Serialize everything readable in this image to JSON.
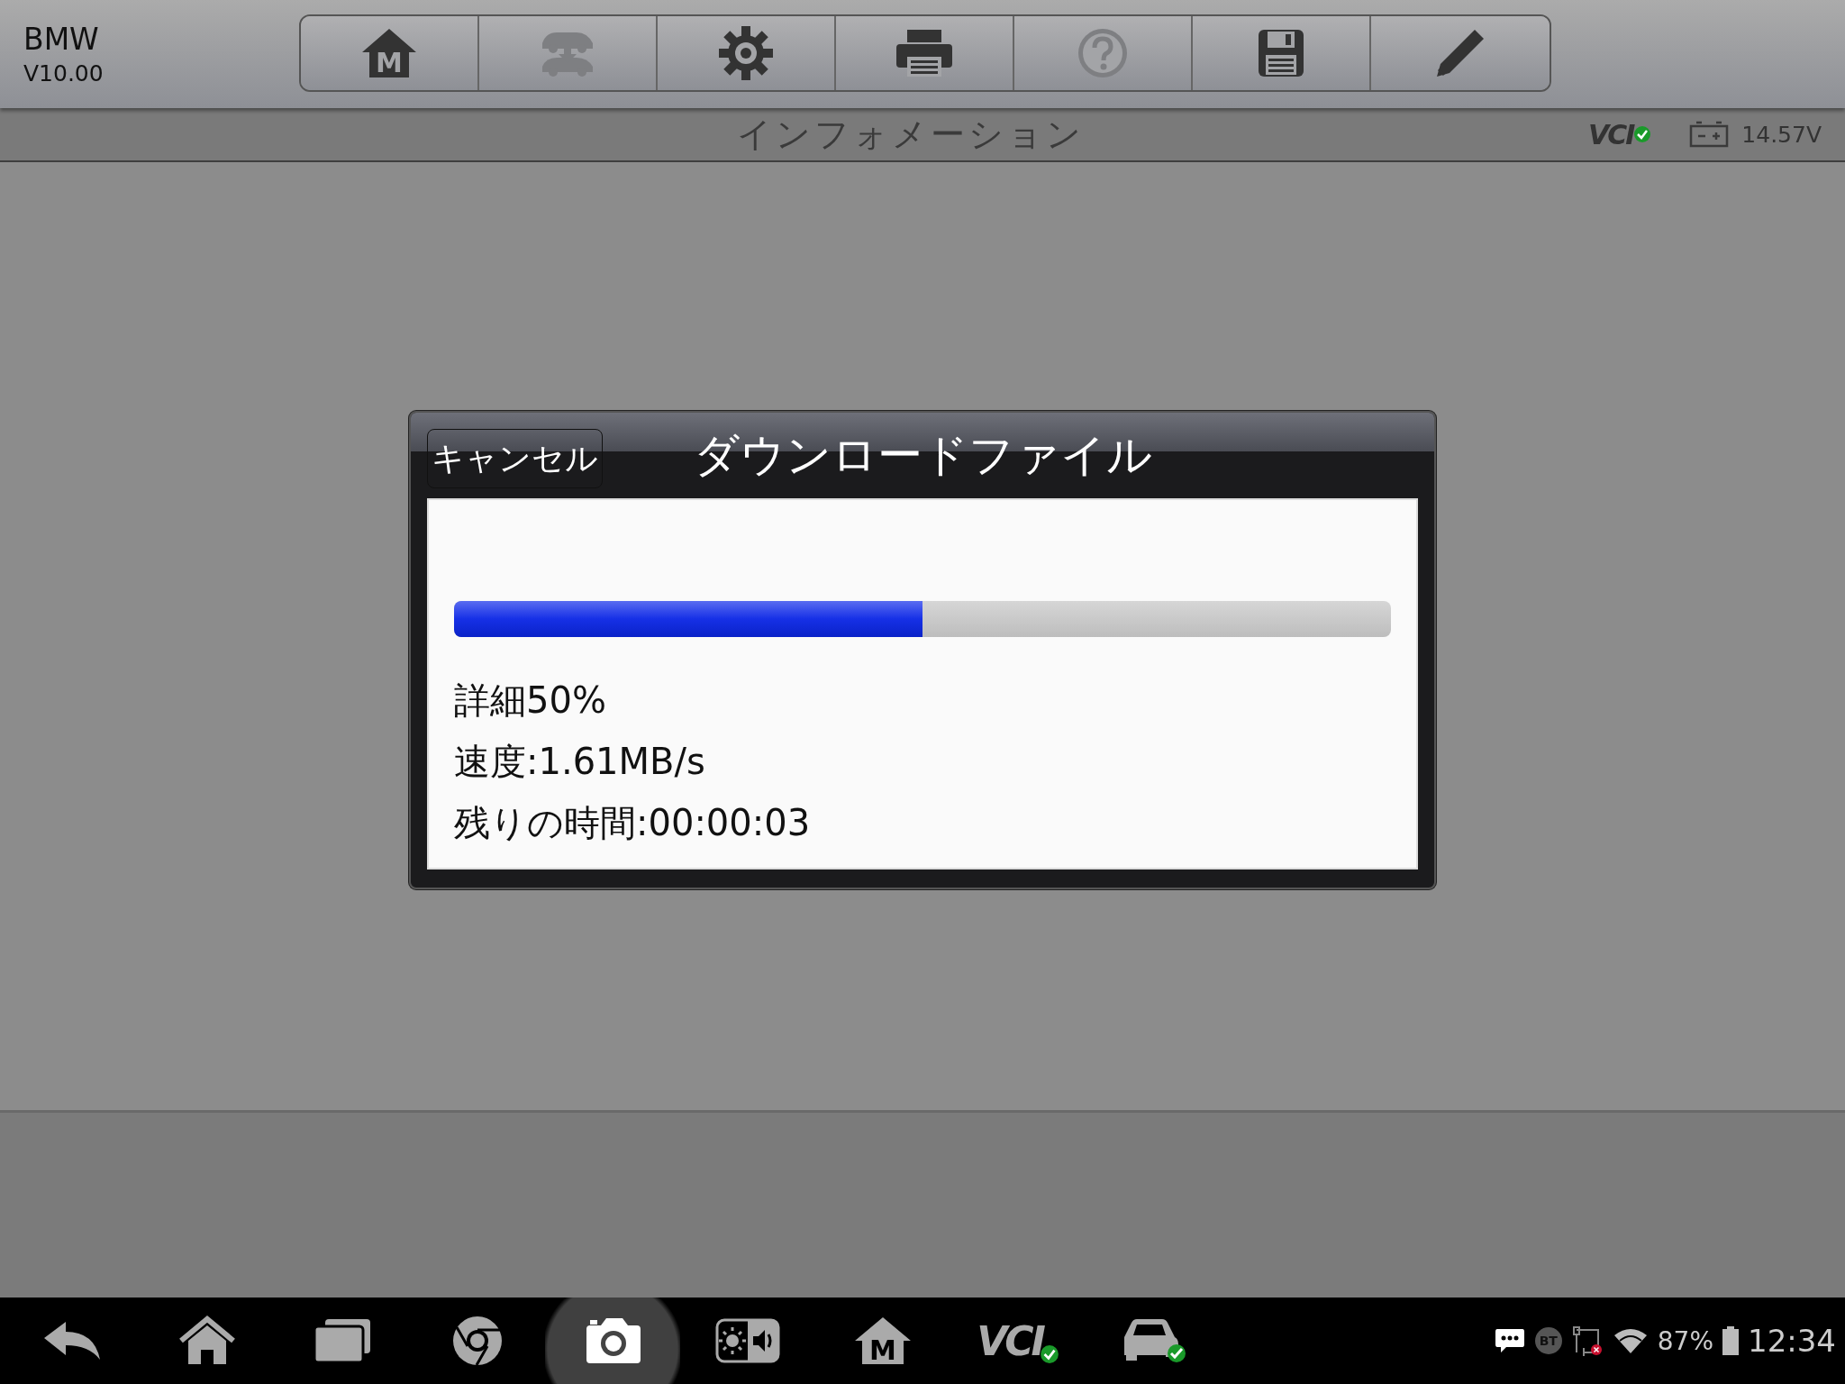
{
  "app": {
    "name": "BMW",
    "version": "V10.00"
  },
  "toolbar": [
    {
      "kind": "home",
      "glyph": "M",
      "disabled": false
    },
    {
      "kind": "transfer",
      "disabled": true
    },
    {
      "kind": "settings",
      "disabled": false
    },
    {
      "kind": "print",
      "disabled": false
    },
    {
      "kind": "help",
      "disabled": true
    },
    {
      "kind": "save",
      "disabled": false
    },
    {
      "kind": "edit",
      "disabled": false
    }
  ],
  "header": {
    "title": "インフォメーション",
    "vci_logo": "VCI",
    "voltage": "14.57V"
  },
  "dialog": {
    "cancel": "キャンセル",
    "title": "ダウンロードファイル",
    "progress": {
      "level": 0.5
    },
    "details": [
      "詳細50%",
      "速度:1.61MB/s",
      "残りの時間:00:00:03"
    ]
  },
  "navbar": {
    "buttons": [
      {
        "kind": "back",
        "selected": false
      },
      {
        "kind": "home",
        "selected": false
      },
      {
        "kind": "recents",
        "selected": false
      },
      {
        "kind": "browser",
        "selected": false
      },
      {
        "kind": "camera",
        "selected": true
      },
      {
        "kind": "brightness",
        "selected": false
      },
      {
        "kind": "app",
        "glyph": "M",
        "selected": false
      },
      {
        "kind": "vci",
        "glyph": "VCI",
        "selected": false
      },
      {
        "kind": "car",
        "selected": false
      }
    ],
    "status": {
      "bt": "BT",
      "battery_percent": "87%",
      "time": "12:34"
    }
  }
}
